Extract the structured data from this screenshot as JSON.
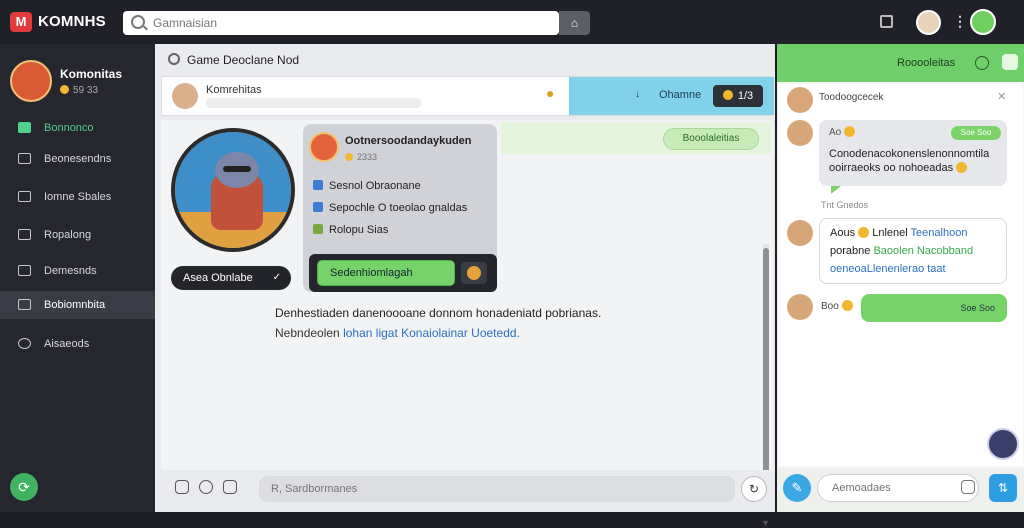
{
  "topbar": {
    "logo_glyph": "M",
    "brand": "KOMNHS",
    "search_placeholder": "Gamnaisian"
  },
  "sidebar": {
    "profile_name": "Komonitas",
    "profile_sub": "59 33",
    "items": [
      {
        "label": "Bonnonco"
      },
      {
        "label": "Beonesendns"
      },
      {
        "label": "Iomne Sbales"
      },
      {
        "label": "Ropalong"
      },
      {
        "label": "Demesnds"
      },
      {
        "label": "Bobiomnbita"
      },
      {
        "label": "Aisaeods"
      }
    ]
  },
  "main": {
    "title": "Game Deoclane Nod",
    "strip_title": "Komrehitas",
    "strip_label": "Ohamne",
    "strip_badge": "1/3",
    "green_pill": "Booolaleitias",
    "char_name": "Asea Obnlabe",
    "card": {
      "title": "Ootnersoodandaykuden",
      "sub": "2333",
      "row1": "Sesnol Obraonane",
      "row2": "Sepochle O toeolao gnaldas",
      "row3": "Rolopu Sias",
      "button": "Sedenhiomlagah"
    },
    "desc_line1": "Denhestiaden danenoooane donnom honadeniatd pobrianas.",
    "desc_line2_a": "Nebndeolen",
    "desc_line2_link": "lohan ligat Konaiolainar Uoetedd.",
    "composer_placeholder": "R, Sardbormanes"
  },
  "chat": {
    "title": "Rooooleitas",
    "top_name": "Toodoogcecek",
    "bubble1_head": "Ao",
    "bubble1_pill": "Soe Soo",
    "bubble1_line1": "Conodenacokonenslenonnomtila",
    "bubble1_line2": "ooirraeoks oo nohoeadas",
    "time_label": "Tnt  Gnedos",
    "bubble2_l1_a": "Aous",
    "bubble2_l1_b": "Lnlenel",
    "bubble2_l1_blue": "Teenalhoon",
    "bubble2_l2_a": "porabne",
    "bubble2_l2_green": "Baoolen Nacobband",
    "bubble2_l3": "oeneoaLlenenlerao taat",
    "bubble3_label": "Boo",
    "bubble3_pill": "Soe Soo",
    "input_placeholder": "Aemoadaes"
  }
}
